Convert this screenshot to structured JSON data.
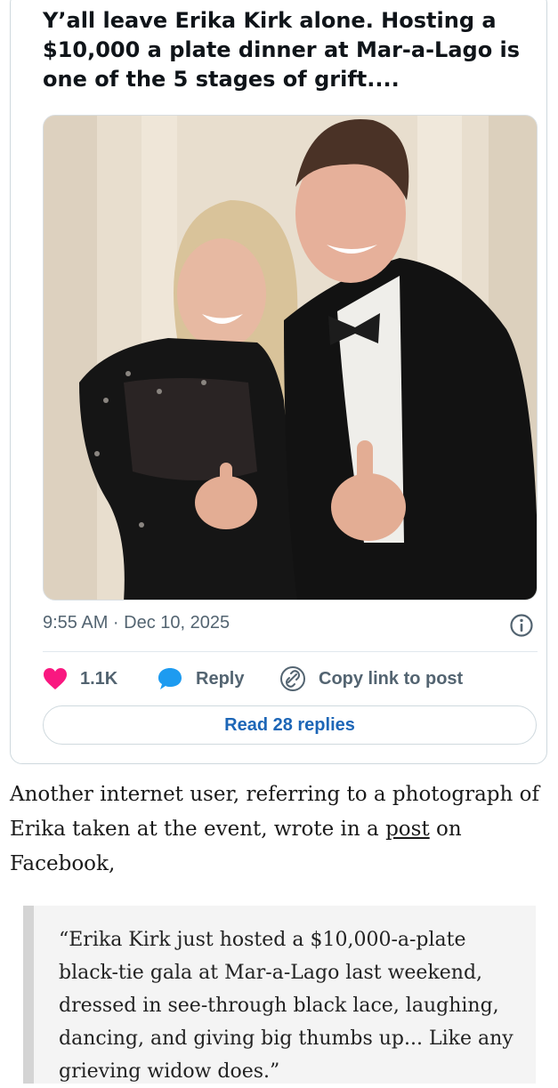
{
  "tweet": {
    "text": "Y’all leave Erika Kirk alone. Hosting a $10,000 a plate dinner at Mar-a-Lago is one of the 5 stages of grift....",
    "timestamp": "9:55 AM · Dec 10, 2025",
    "likes": "1.1K",
    "reply_label": "Reply",
    "copy_label": "Copy link to post",
    "read_replies": "Read 28 replies"
  },
  "article": {
    "before_link": "Another internet user, referring to a photograph of Erika taken at the event, wrote in a ",
    "link_text": "post",
    "after_link": " on Facebook,",
    "quote": "“Erika Kirk just hosted a $10,000-a-plate black-tie gala at Mar-a-Lago last weekend, dressed in see-through black lace, laughing, dancing, and giving big thumbs up... Like any grieving widow does.”"
  },
  "colors": {
    "heart": "#f91880",
    "reply_bubble": "#1d9bf0",
    "link_blue": "#1d66b7",
    "meta_gray": "#536471"
  },
  "icons": [
    "heart-icon",
    "reply-bubble-icon",
    "link-icon",
    "info-icon"
  ]
}
